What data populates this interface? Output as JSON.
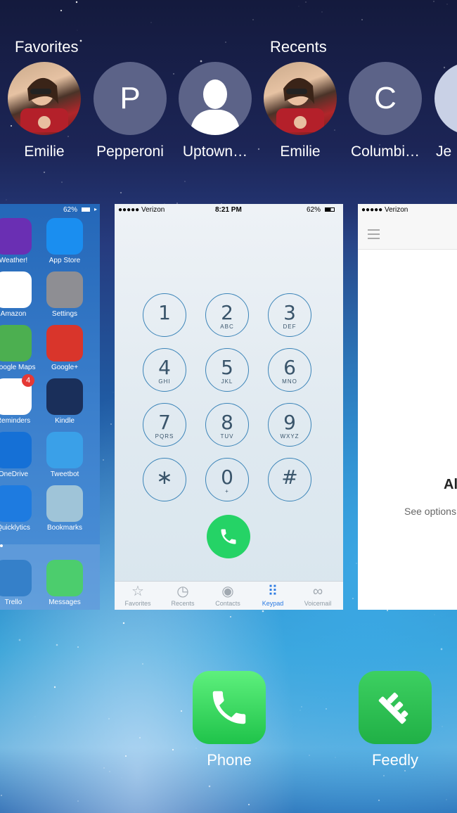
{
  "switcher": {
    "favorites_label": "Favorites",
    "recents_label": "Recents",
    "favorites": [
      {
        "name": "Emilie",
        "avatar": "photo"
      },
      {
        "name": "Pepperoni",
        "avatar": "P"
      },
      {
        "name": "Uptown…",
        "avatar": "silhouette"
      }
    ],
    "recents": [
      {
        "name": "Emilie",
        "avatar": "photo"
      },
      {
        "name": "Columbi…",
        "avatar": "C"
      },
      {
        "name": "Je",
        "avatar": "partial"
      }
    ]
  },
  "home_card": {
    "battery": "62%",
    "apps": [
      {
        "label": "Weather!",
        "icon": "weather-icon",
        "color": "#6a2fb3"
      },
      {
        "label": "App Store",
        "icon": "app-store-icon",
        "color": "#1a8ef0"
      },
      {
        "label": "Amazon",
        "icon": "amazon-icon",
        "color": "#ffffff"
      },
      {
        "label": "Settings",
        "icon": "settings-icon",
        "color": "#8e8e93"
      },
      {
        "label": "Google Maps",
        "icon": "google-maps-icon",
        "color": "#4caf50"
      },
      {
        "label": "Google+",
        "icon": "google-plus-icon",
        "color": "#d9352b"
      },
      {
        "label": "Reminders",
        "icon": "reminders-icon",
        "color": "#ffffff",
        "badge": "4"
      },
      {
        "label": "Kindle",
        "icon": "kindle-icon",
        "color": "#1a2f5a"
      },
      {
        "label": "OneDrive",
        "icon": "onedrive-icon",
        "color": "#1570d6"
      },
      {
        "label": "Tweetbot",
        "icon": "tweetbot-icon",
        "color": "#3aa0e8"
      },
      {
        "label": "Quicklytics",
        "icon": "quicklytics-icon",
        "color": "#1e7be0"
      },
      {
        "label": "Bookmarks",
        "icon": "bookmarks-folder-icon",
        "color": "#9fc4d8"
      },
      {
        "label": "Trello",
        "icon": "trello-icon",
        "color": "#1a6fc2"
      },
      {
        "label": "Messages",
        "icon": "messages-icon",
        "color": "#34c759"
      }
    ]
  },
  "phone_card": {
    "carrier": "●●●●● Verizon",
    "time": "8:21 PM",
    "battery": "62%",
    "keys": [
      {
        "digit": "1",
        "letters": ""
      },
      {
        "digit": "2",
        "letters": "ABC"
      },
      {
        "digit": "3",
        "letters": "DEF"
      },
      {
        "digit": "4",
        "letters": "GHI"
      },
      {
        "digit": "5",
        "letters": "JKL"
      },
      {
        "digit": "6",
        "letters": "MNO"
      },
      {
        "digit": "7",
        "letters": "PQRS"
      },
      {
        "digit": "8",
        "letters": "TUV"
      },
      {
        "digit": "9",
        "letters": "WXYZ"
      },
      {
        "digit": "∗",
        "letters": ""
      },
      {
        "digit": "0",
        "letters": "+"
      },
      {
        "digit": "#",
        "letters": ""
      }
    ],
    "tabs": [
      {
        "label": "Favorites",
        "icon": "star-icon"
      },
      {
        "label": "Recents",
        "icon": "clock-icon"
      },
      {
        "label": "Contacts",
        "icon": "contacts-icon"
      },
      {
        "label": "Keypad",
        "icon": "keypad-icon",
        "active": true
      },
      {
        "label": "Voicemail",
        "icon": "voicemail-icon"
      }
    ],
    "accent": "#2a7ae2",
    "call_color": "#25d366"
  },
  "feedly_card": {
    "carrier": "●●●●● Verizon",
    "heading_partial": "Al",
    "subtext_partial": "See options"
  },
  "dock": {
    "apps": [
      {
        "label": "Phone",
        "icon": "phone-icon",
        "color": "#2bd65a"
      },
      {
        "label": "Feedly",
        "icon": "feedly-icon",
        "color": "#2bbb4f"
      }
    ]
  }
}
